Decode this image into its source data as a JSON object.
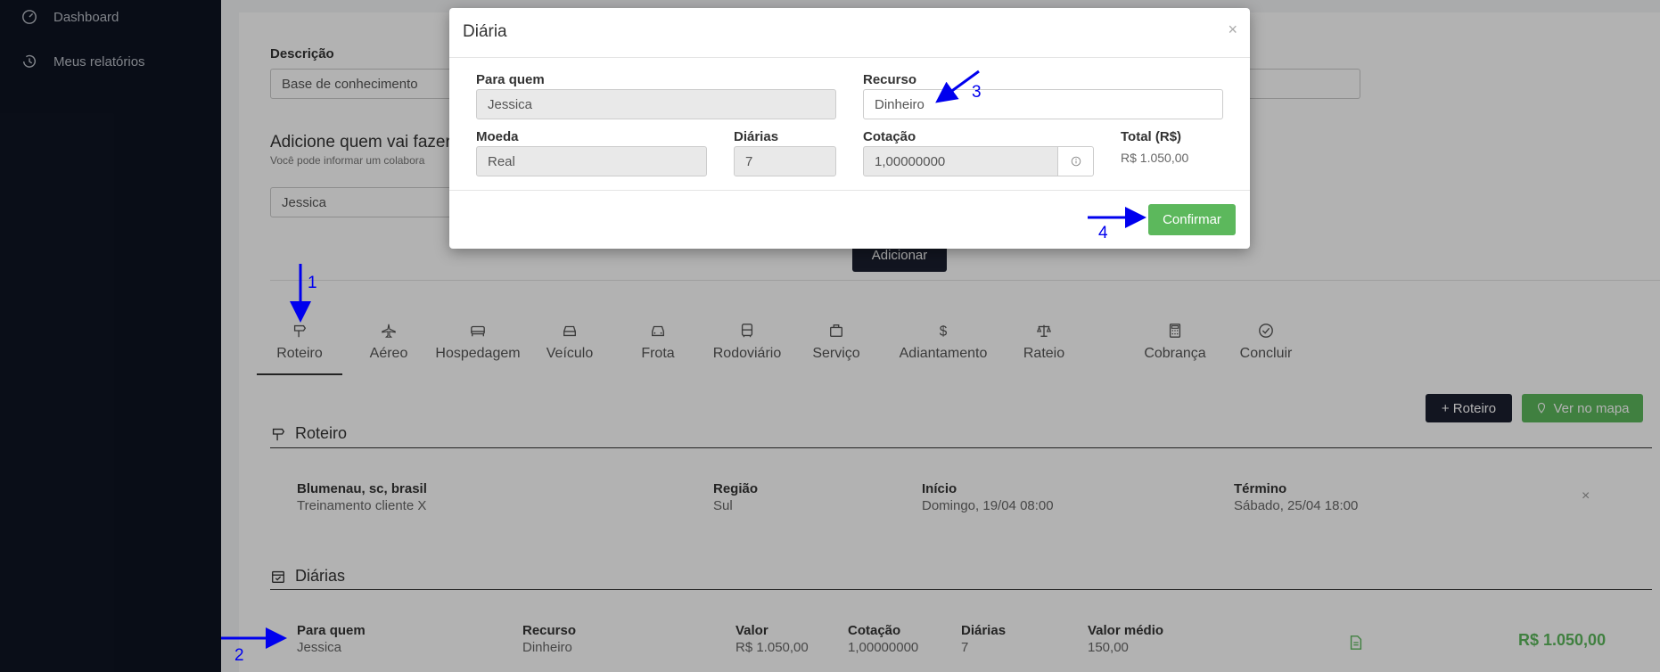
{
  "sidebar": {
    "items": [
      {
        "label": "Dashboard",
        "icon": "dashboard-icon"
      },
      {
        "label": "Meus relatórios",
        "icon": "history-icon"
      }
    ]
  },
  "form": {
    "descricao_label": "Descrição",
    "descricao_value": "Base de conhecimento",
    "adicione_title": "Adicione quem vai fazer",
    "adicione_sub": "Você pode informar um colabora",
    "colaborador_value": "Jessica",
    "adicionar_button": "Adicionar"
  },
  "tabs": [
    {
      "label": "Roteiro",
      "icon": "signpost-icon",
      "active": true
    },
    {
      "label": "Aéreo",
      "icon": "airplane-icon"
    },
    {
      "label": "Hospedagem",
      "icon": "bed-icon"
    },
    {
      "label": "Veículo",
      "icon": "car-icon"
    },
    {
      "label": "Frota",
      "icon": "fleet-car-icon"
    },
    {
      "label": "Rodoviário",
      "icon": "bus-icon"
    },
    {
      "label": "Serviço",
      "icon": "briefcase-icon"
    },
    {
      "label": "Adiantamento",
      "icon": "dollar-icon"
    },
    {
      "label": "Rateio",
      "icon": "scale-icon"
    },
    {
      "label": "Cobrança",
      "icon": "calculator-icon"
    },
    {
      "label": "Concluir",
      "icon": "check-circle-icon"
    }
  ],
  "actions": {
    "roteiro_button": "+ Roteiro",
    "mapa_button": "Ver no mapa"
  },
  "roteiro_section": {
    "title": "Roteiro",
    "row": {
      "city": "Blumenau, sc, brasil",
      "desc": "Treinamento cliente X",
      "regiao_label": "Região",
      "regiao_value": "Sul",
      "inicio_label": "Início",
      "inicio_value": "Domingo, 19/04 08:00",
      "termino_label": "Término",
      "termino_value": "Sábado, 25/04 18:00"
    }
  },
  "diarias_section": {
    "title": "Diárias",
    "row": {
      "para_quem_label": "Para quem",
      "para_quem_value": "Jessica",
      "recurso_label": "Recurso",
      "recurso_value": "Dinheiro",
      "valor_label": "Valor",
      "valor_value": "R$ 1.050,00",
      "cotacao_label": "Cotação",
      "cotacao_value": "1,00000000",
      "diarias_label": "Diárias",
      "diarias_value": "7",
      "valor_medio_label": "Valor médio",
      "valor_medio_value": "150,00",
      "total": "R$ 1.050,00"
    }
  },
  "modal": {
    "title": "Diária",
    "close": "×",
    "para_quem_label": "Para quem",
    "para_quem_value": "Jessica",
    "recurso_label": "Recurso",
    "recurso_value": "Dinheiro",
    "moeda_label": "Moeda",
    "moeda_value": "Real",
    "diarias_label": "Diárias",
    "diarias_value": "7",
    "cotacao_label": "Cotação",
    "cotacao_value": "1,00000000",
    "total_label": "Total (R$)",
    "total_value": "R$ 1.050,00",
    "confirm_button": "Confirmar"
  },
  "annotations": {
    "n1": "1",
    "n2": "2",
    "n3": "3",
    "n4": "4"
  },
  "colors": {
    "sidebar": "#0e1422",
    "confirm": "#5cb85c",
    "dark_button": "#1b1f2e",
    "arrow": "#0000ee"
  }
}
